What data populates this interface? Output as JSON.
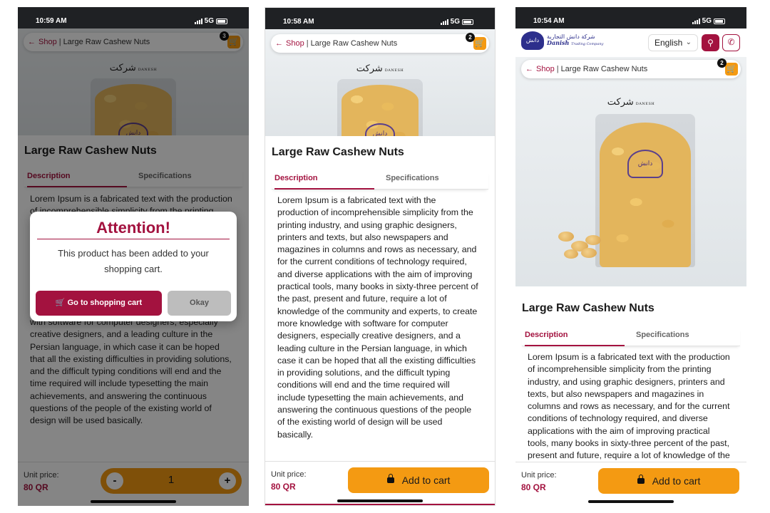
{
  "product": {
    "title": "Large Raw Cashew Nuts",
    "description": "Lorem Ipsum is a fabricated text with the production of incomprehensible simplicity from the printing industry, and using graphic designers, printers and texts, but also newspapers and magazines in columns and rows as necessary, and for the current conditions of technology required, and diverse applications with the aim of improving practical tools, many books in sixty-three percent of the past, present and future, require a lot of knowledge of the community and experts, to create more knowledge with software for computer designers, especially creative designers, and a leading culture in the Persian language, in which case it can be hoped that all the existing difficulties in providing solutions, and the difficult typing conditions will end and the time required will include typesetting the main achievements, and answering the continuous questions of the people of the existing world of design will be used basically.",
    "unit_price_label": "Unit price:",
    "price": "80 QR",
    "image_logo_text": "شرکت"
  },
  "breadcrumb": {
    "shop": "Shop",
    "separator": "|",
    "title": "Large Raw Cashew Nuts"
  },
  "tabs": {
    "description": "Description",
    "specifications": "Specifications"
  },
  "add_to_cart_label": "Add to cart",
  "header": {
    "brand_arabic": "شركة دانش التجارية",
    "brand_english": "Danish",
    "brand_english_sub": "Trading Company",
    "language": "English"
  },
  "screens": [
    {
      "time": "10:59 AM",
      "network": "5G",
      "cart_count": "3",
      "quantity": "1"
    },
    {
      "time": "10:58 AM",
      "network": "5G",
      "cart_count": "2"
    },
    {
      "time": "10:54 AM",
      "network": "5G",
      "cart_count": "2"
    }
  ],
  "modal": {
    "title": "Attention!",
    "message": "This product has been added to your shopping cart.",
    "go_to_cart": "Go to shopping cart",
    "okay": "Okay"
  },
  "stepper": {
    "minus": "-",
    "plus": "+"
  },
  "colors": {
    "brand": "#a3123f",
    "accent": "#f49a12",
    "statusbar": "#1f2124"
  },
  "icons": [
    "back-arrow-icon",
    "cart-icon",
    "lock-icon",
    "search-icon",
    "phone-icon",
    "chevron-down-icon"
  ]
}
